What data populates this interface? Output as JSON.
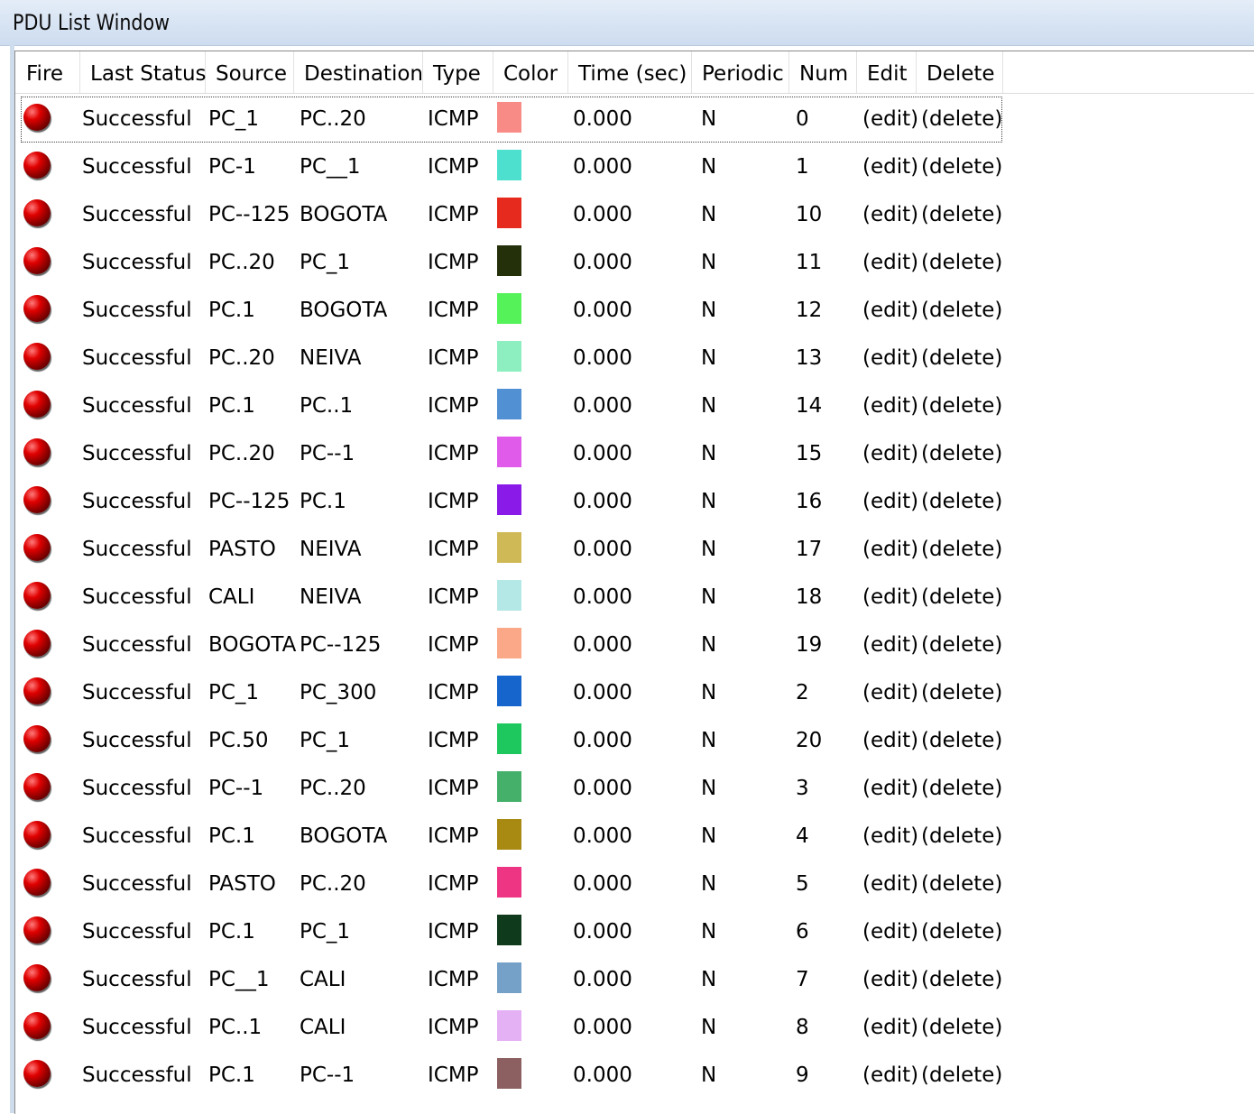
{
  "window": {
    "title": "PDU List Window"
  },
  "columns": [
    "Fire",
    "Last Status",
    "Source",
    "Destination",
    "Type",
    "Color",
    "Time (sec)",
    "Periodic",
    "Num",
    "Edit",
    "Delete"
  ],
  "rows": [
    {
      "status": "Successful",
      "source": "PC_1",
      "destination": "PC..20",
      "type": "ICMP",
      "color": "#f88b86",
      "time": "0.000",
      "periodic": "N",
      "num": "0",
      "edit": "(edit)",
      "delete": "(delete)"
    },
    {
      "status": "Successful",
      "source": "PC-1",
      "destination": "PC__1",
      "type": "ICMP",
      "color": "#4ee0cf",
      "time": "0.000",
      "periodic": "N",
      "num": "1",
      "edit": "(edit)",
      "delete": "(delete)"
    },
    {
      "status": "Successful",
      "source": "PC--125",
      "destination": "BOGOTA",
      "type": "ICMP",
      "color": "#e62a1e",
      "time": "0.000",
      "periodic": "N",
      "num": "10",
      "edit": "(edit)",
      "delete": "(delete)"
    },
    {
      "status": "Successful",
      "source": "PC..20",
      "destination": "PC_1",
      "type": "ICMP",
      "color": "#24300a",
      "time": "0.000",
      "periodic": "N",
      "num": "11",
      "edit": "(edit)",
      "delete": "(delete)"
    },
    {
      "status": "Successful",
      "source": "PC.1",
      "destination": "BOGOTA",
      "type": "ICMP",
      "color": "#55f25a",
      "time": "0.000",
      "periodic": "N",
      "num": "12",
      "edit": "(edit)",
      "delete": "(delete)"
    },
    {
      "status": "Successful",
      "source": "PC..20",
      "destination": "NEIVA",
      "type": "ICMP",
      "color": "#8deebf",
      "time": "0.000",
      "periodic": "N",
      "num": "13",
      "edit": "(edit)",
      "delete": "(delete)"
    },
    {
      "status": "Successful",
      "source": "PC.1",
      "destination": "PC..1",
      "type": "ICMP",
      "color": "#5290d4",
      "time": "0.000",
      "periodic": "N",
      "num": "14",
      "edit": "(edit)",
      "delete": "(delete)"
    },
    {
      "status": "Successful",
      "source": "PC..20",
      "destination": "PC--1",
      "type": "ICMP",
      "color": "#e05be9",
      "time": "0.000",
      "periodic": "N",
      "num": "15",
      "edit": "(edit)",
      "delete": "(delete)"
    },
    {
      "status": "Successful",
      "source": "PC--125",
      "destination": "PC.1",
      "type": "ICMP",
      "color": "#8a1ae8",
      "time": "0.000",
      "periodic": "N",
      "num": "16",
      "edit": "(edit)",
      "delete": "(delete)"
    },
    {
      "status": "Successful",
      "source": "PASTO",
      "destination": "NEIVA",
      "type": "ICMP",
      "color": "#cfb956",
      "time": "0.000",
      "periodic": "N",
      "num": "17",
      "edit": "(edit)",
      "delete": "(delete)"
    },
    {
      "status": "Successful",
      "source": "CALI",
      "destination": "NEIVA",
      "type": "ICMP",
      "color": "#b3e8e6",
      "time": "0.000",
      "periodic": "N",
      "num": "18",
      "edit": "(edit)",
      "delete": "(delete)"
    },
    {
      "status": "Successful",
      "source": "BOGOTA",
      "destination": "PC--125",
      "type": "ICMP",
      "color": "#fba888",
      "time": "0.000",
      "periodic": "N",
      "num": "19",
      "edit": "(edit)",
      "delete": "(delete)"
    },
    {
      "status": "Successful",
      "source": "PC_1",
      "destination": "PC_300",
      "type": "ICMP",
      "color": "#1565cc",
      "time": "0.000",
      "periodic": "N",
      "num": "2",
      "edit": "(edit)",
      "delete": "(delete)"
    },
    {
      "status": "Successful",
      "source": "PC.50",
      "destination": "PC_1",
      "type": "ICMP",
      "color": "#1ec85e",
      "time": "0.000",
      "periodic": "N",
      "num": "20",
      "edit": "(edit)",
      "delete": "(delete)"
    },
    {
      "status": "Successful",
      "source": "PC--1",
      "destination": "PC..20",
      "type": "ICMP",
      "color": "#45b06a",
      "time": "0.000",
      "periodic": "N",
      "num": "3",
      "edit": "(edit)",
      "delete": "(delete)"
    },
    {
      "status": "Successful",
      "source": "PC.1",
      "destination": "BOGOTA",
      "type": "ICMP",
      "color": "#a88a13",
      "time": "0.000",
      "periodic": "N",
      "num": "4",
      "edit": "(edit)",
      "delete": "(delete)"
    },
    {
      "status": "Successful",
      "source": "PASTO",
      "destination": "PC..20",
      "type": "ICMP",
      "color": "#ed3584",
      "time": "0.000",
      "periodic": "N",
      "num": "5",
      "edit": "(edit)",
      "delete": "(delete)"
    },
    {
      "status": "Successful",
      "source": "PC.1",
      "destination": "PC_1",
      "type": "ICMP",
      "color": "#0f3a1c",
      "time": "0.000",
      "periodic": "N",
      "num": "6",
      "edit": "(edit)",
      "delete": "(delete)"
    },
    {
      "status": "Successful",
      "source": "PC__1",
      "destination": "CALI",
      "type": "ICMP",
      "color": "#75a1c9",
      "time": "0.000",
      "periodic": "N",
      "num": "7",
      "edit": "(edit)",
      "delete": "(delete)"
    },
    {
      "status": "Successful",
      "source": "PC..1",
      "destination": "CALI",
      "type": "ICMP",
      "color": "#e5b1f5",
      "time": "0.000",
      "periodic": "N",
      "num": "8",
      "edit": "(edit)",
      "delete": "(delete)"
    },
    {
      "status": "Successful",
      "source": "PC.1",
      "destination": "PC--1",
      "type": "ICMP",
      "color": "#8c6060",
      "time": "0.000",
      "periodic": "N",
      "num": "9",
      "edit": "(edit)",
      "delete": "(delete)"
    }
  ]
}
